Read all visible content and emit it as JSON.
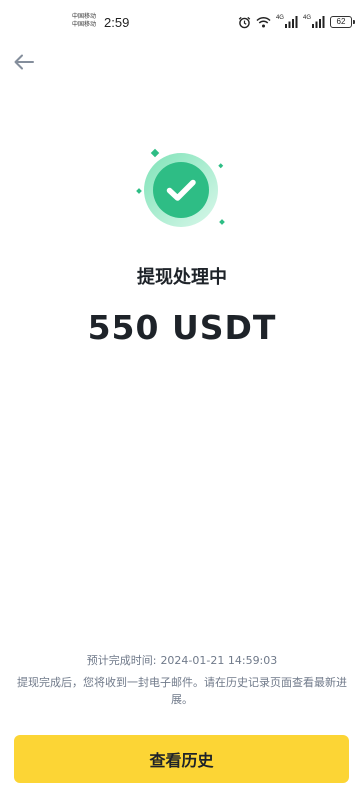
{
  "status_bar": {
    "carrier_1": "中国移动",
    "carrier_2": "中国移动",
    "time": "2:59",
    "network_1": "4G",
    "network_2": "4G",
    "battery": "62",
    "icons": [
      "alarm-icon",
      "wifi-icon",
      "signal-icon",
      "signal-icon",
      "battery-icon"
    ]
  },
  "nav": {
    "back_icon": "arrow-left-icon"
  },
  "result": {
    "icon": "check-circle-icon",
    "accent_color": "#2ebd85",
    "title": "提现处理中",
    "amount": "550 USDT"
  },
  "footer": {
    "eta_label": "预计完成时间:",
    "eta_time": "2024-01-21 14:59:03",
    "notice": "提现完成后，您将收到一封电子邮件。请在历史记录页面查看最新进展。",
    "button_label": "查看历史",
    "button_color": "#fcd535"
  }
}
